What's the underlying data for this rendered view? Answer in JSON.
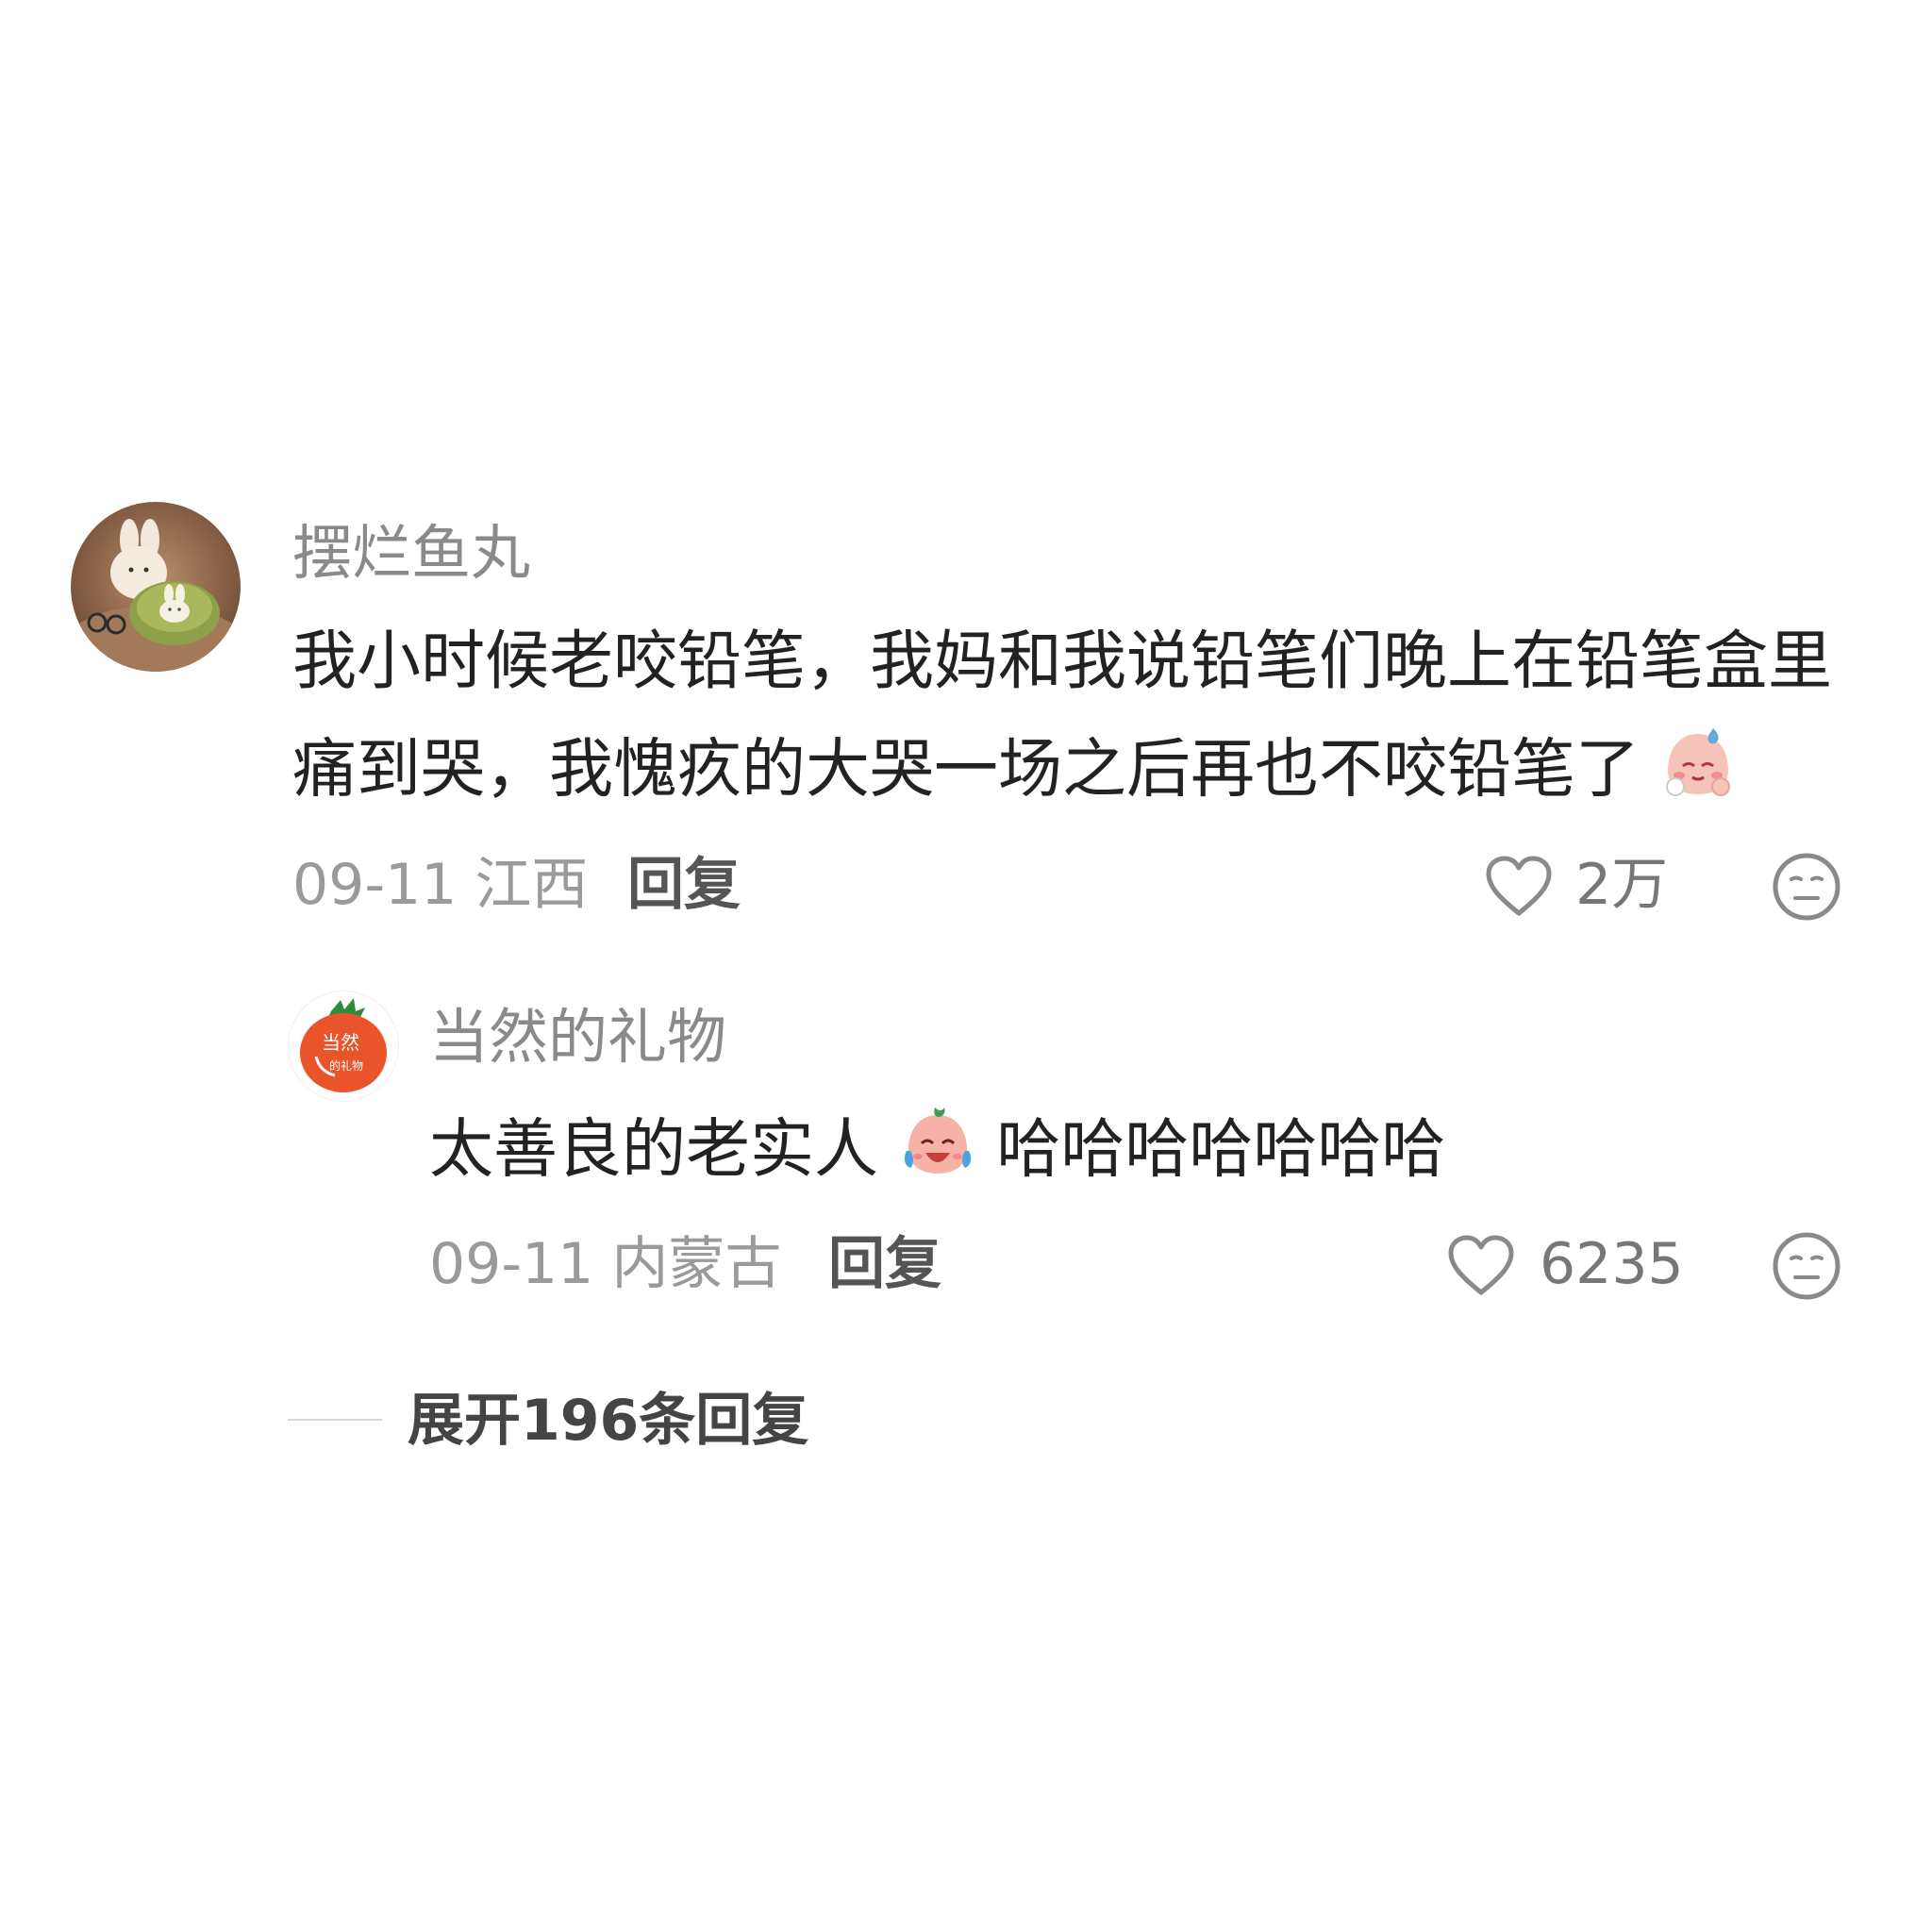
{
  "comment": {
    "username": "摆烂鱼丸",
    "text_line_1": "我小时候老咬铅笔，我妈和我说铅笔们晚上在铅笔盒里",
    "text_line_2": "痛到哭，我愧疚的大哭一场之后再也不咬铅笔了",
    "text_emoji": "sad-crying-face-emoji",
    "date_location": "09-11 江西",
    "reply_label": "回复",
    "like_count": "2万"
  },
  "reply": {
    "username": "当然的礼物",
    "avatar_text_1": "当然",
    "avatar_text_2": "的礼物",
    "text_before_emoji": "太善良的老实人",
    "text_emoji": "laugh-crying-face-emoji",
    "text_after_emoji": "哈哈哈哈哈哈哈",
    "date_location": "09-11 内蒙古",
    "reply_label": "回复",
    "like_count": "6235"
  },
  "expand": {
    "label": "展开196条回复"
  },
  "colors": {
    "username": "#8a8a8a",
    "body_text": "#222222",
    "meta": "#9a9a9a",
    "avatar_tomato": "#e9542a"
  }
}
